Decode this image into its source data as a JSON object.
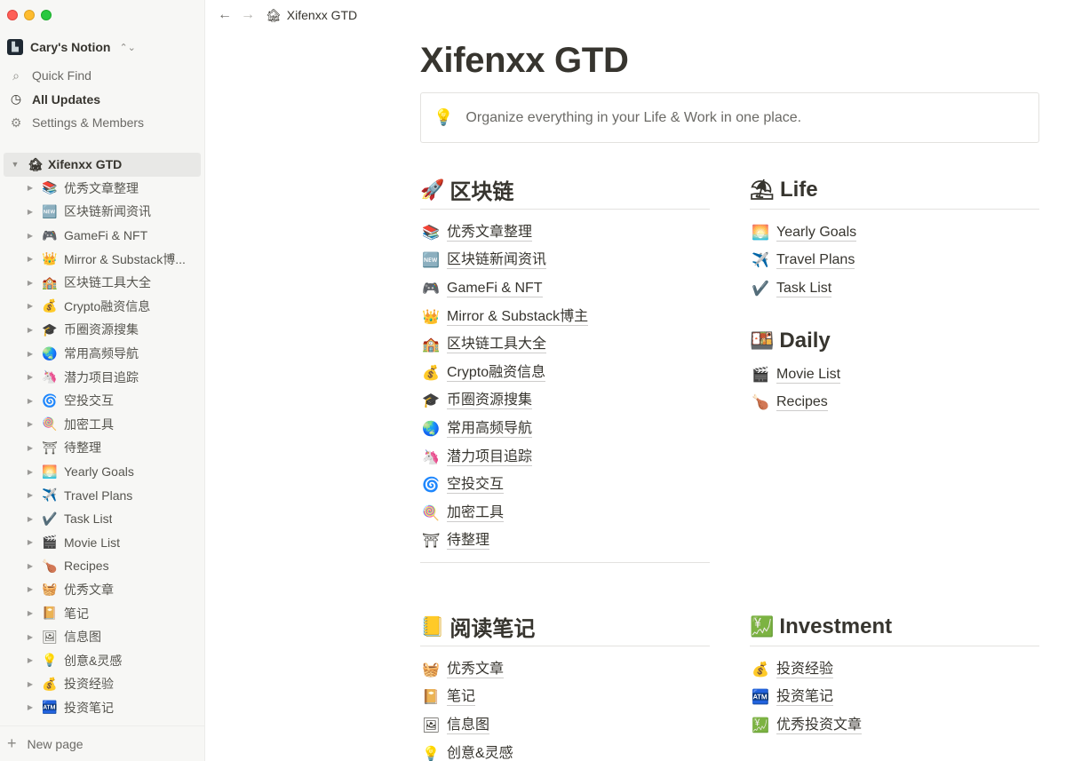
{
  "window": {
    "traffic_lights": [
      "close",
      "minimize",
      "maximize"
    ]
  },
  "sidebar": {
    "workspace": {
      "name": "Cary's Notion",
      "icon": "workspace-logo",
      "chevrons": "⌃⌄"
    },
    "top_links": [
      {
        "label": "Quick Find",
        "icon": "search-icon",
        "glyph": "⌕"
      },
      {
        "label": "All Updates",
        "icon": "clock-icon",
        "glyph": "◷"
      },
      {
        "label": "Settings & Members",
        "icon": "gear-icon",
        "glyph": "⚙"
      }
    ],
    "root": {
      "emoji": "🏚",
      "label": "Xifenxx GTD"
    },
    "items": [
      {
        "emoji": "📚",
        "label": "优秀文章整理"
      },
      {
        "emoji": "🆕",
        "label": "区块链新闻资讯"
      },
      {
        "emoji": "🎮",
        "label": "GameFi & NFT"
      },
      {
        "emoji": "👑",
        "label": "Mirror & Substack博..."
      },
      {
        "emoji": "🏫",
        "label": "区块链工具大全"
      },
      {
        "emoji": "💰",
        "label": "Crypto融资信息"
      },
      {
        "emoji": "🎓",
        "label": "币圈资源搜集"
      },
      {
        "emoji": "🌏",
        "label": "常用高频导航"
      },
      {
        "emoji": "🦄",
        "label": "潜力项目追踪"
      },
      {
        "emoji": "🌀",
        "label": "空投交互"
      },
      {
        "emoji": "🍭",
        "label": "加密工具"
      },
      {
        "emoji": "⛩",
        "label": "待整理"
      },
      {
        "emoji": "🌅",
        "label": "Yearly Goals"
      },
      {
        "emoji": "✈️",
        "label": "Travel Plans"
      },
      {
        "emoji": "✔️",
        "label": "Task List"
      },
      {
        "emoji": "🎬",
        "label": "Movie List"
      },
      {
        "emoji": "🍗",
        "label": "Recipes"
      },
      {
        "emoji": "🧺",
        "label": "优秀文章"
      },
      {
        "emoji": "📔",
        "label": "笔记"
      },
      {
        "emoji": "🖼",
        "label": "信息图"
      },
      {
        "emoji": "💡",
        "label": "创意&灵感"
      },
      {
        "emoji": "💰",
        "label": "投资经验"
      },
      {
        "emoji": "🏧",
        "label": "投资笔记"
      }
    ],
    "new_page": {
      "label": "New page",
      "glyph": "+"
    }
  },
  "topbar": {
    "back_glyph": "←",
    "forward_glyph": "→",
    "breadcrumb": {
      "emoji": "🏚",
      "label": "Xifenxx GTD"
    }
  },
  "page": {
    "title": "Xifenxx GTD",
    "callout": {
      "emoji": "💡",
      "text": "Organize everything in your Life & Work in one place."
    }
  },
  "sections": {
    "blockchain": {
      "emoji": "🚀",
      "title": "区块链",
      "items": [
        {
          "emoji": "📚",
          "label": "优秀文章整理"
        },
        {
          "emoji": "🆕",
          "label": "区块链新闻资讯"
        },
        {
          "emoji": "🎮",
          "label": "GameFi & NFT"
        },
        {
          "emoji": "👑",
          "label": "Mirror & Substack博主"
        },
        {
          "emoji": "🏫",
          "label": "区块链工具大全"
        },
        {
          "emoji": "💰",
          "label": "Crypto融资信息"
        },
        {
          "emoji": "🎓",
          "label": "币圈资源搜集"
        },
        {
          "emoji": "🌏",
          "label": "常用高频导航"
        },
        {
          "emoji": "🦄",
          "label": "潜力项目追踪"
        },
        {
          "emoji": "🌀",
          "label": "空投交互"
        },
        {
          "emoji": "🍭",
          "label": "加密工具"
        },
        {
          "emoji": "⛩",
          "label": "待整理"
        }
      ]
    },
    "life": {
      "emoji": "⛱",
      "title": "Life",
      "items": [
        {
          "emoji": "🌅",
          "label": "Yearly Goals"
        },
        {
          "emoji": "✈️",
          "label": "Travel Plans"
        },
        {
          "emoji": "✔️",
          "label": "Task List"
        }
      ]
    },
    "daily": {
      "emoji": "🍱",
      "title": "Daily",
      "items": [
        {
          "emoji": "🎬",
          "label": "Movie List"
        },
        {
          "emoji": "🍗",
          "label": "Recipes"
        }
      ]
    },
    "reading": {
      "emoji": "📒",
      "title": "阅读笔记",
      "items": [
        {
          "emoji": "🧺",
          "label": "优秀文章"
        },
        {
          "emoji": "📔",
          "label": "笔记"
        },
        {
          "emoji": "🖼",
          "label": "信息图"
        },
        {
          "emoji": "💡",
          "label": "创意&灵感"
        }
      ]
    },
    "investment": {
      "emoji": "💹",
      "title": "Investment",
      "items": [
        {
          "emoji": "💰",
          "label": "投资经验"
        },
        {
          "emoji": "🏧",
          "label": "投资笔记"
        },
        {
          "emoji": "💹",
          "label": "优秀投资文章"
        }
      ]
    }
  }
}
